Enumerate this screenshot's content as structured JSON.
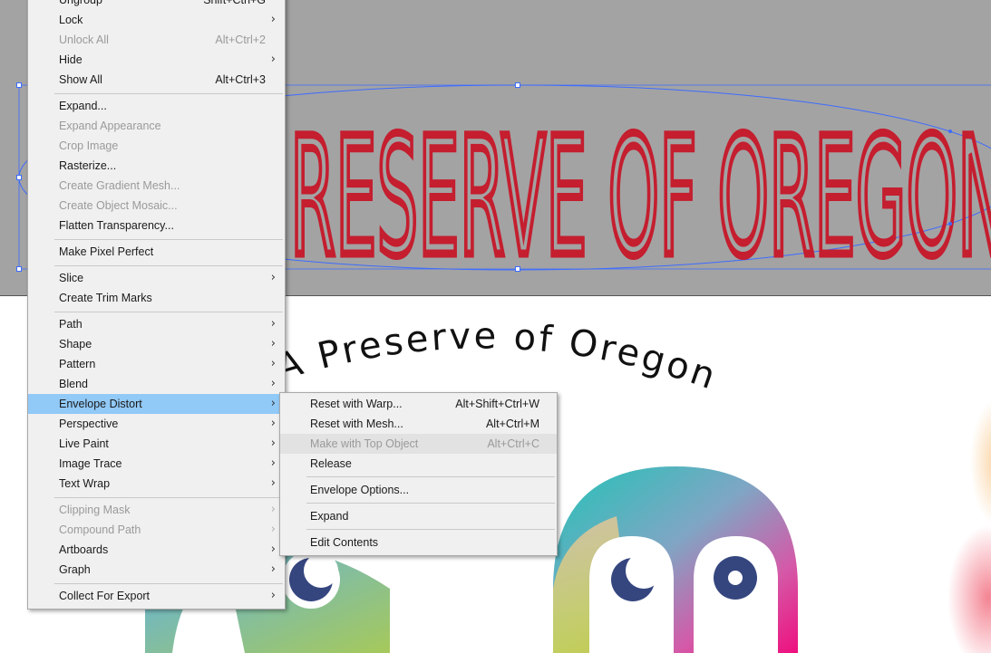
{
  "canvas": {
    "banner_text": "RESERVE OF OREGON",
    "curved_text": "A Preserve of Oregon",
    "colors": {
      "band": "#a3a3a3",
      "banner_text": "#c41e2f",
      "selection": "#3d6bff",
      "eye_dark": "#35467f"
    }
  },
  "main_menu": {
    "items": [
      {
        "label": "Ungroup",
        "shortcut": "Shift+Ctrl+G",
        "arrow": false,
        "disabled": false
      },
      {
        "label": "Lock",
        "shortcut": "",
        "arrow": true,
        "disabled": false
      },
      {
        "label": "Unlock All",
        "shortcut": "Alt+Ctrl+2",
        "arrow": false,
        "disabled": true
      },
      {
        "label": "Hide",
        "shortcut": "",
        "arrow": true,
        "disabled": false
      },
      {
        "label": "Show All",
        "shortcut": "Alt+Ctrl+3",
        "arrow": false,
        "disabled": false
      },
      {
        "label": "Expand...",
        "shortcut": "",
        "arrow": false,
        "disabled": false
      },
      {
        "label": "Expand Appearance",
        "shortcut": "",
        "arrow": false,
        "disabled": true
      },
      {
        "label": "Crop Image",
        "shortcut": "",
        "arrow": false,
        "disabled": true
      },
      {
        "label": "Rasterize...",
        "shortcut": "",
        "arrow": false,
        "disabled": false
      },
      {
        "label": "Create Gradient Mesh...",
        "shortcut": "",
        "arrow": false,
        "disabled": true
      },
      {
        "label": "Create Object Mosaic...",
        "shortcut": "",
        "arrow": false,
        "disabled": true
      },
      {
        "label": "Flatten Transparency...",
        "shortcut": "",
        "arrow": false,
        "disabled": false
      },
      {
        "label": "Make Pixel Perfect",
        "shortcut": "",
        "arrow": false,
        "disabled": false
      },
      {
        "label": "Slice",
        "shortcut": "",
        "arrow": true,
        "disabled": false
      },
      {
        "label": "Create Trim Marks",
        "shortcut": "",
        "arrow": false,
        "disabled": false
      },
      {
        "label": "Path",
        "shortcut": "",
        "arrow": true,
        "disabled": false
      },
      {
        "label": "Shape",
        "shortcut": "",
        "arrow": true,
        "disabled": false
      },
      {
        "label": "Pattern",
        "shortcut": "",
        "arrow": true,
        "disabled": false
      },
      {
        "label": "Blend",
        "shortcut": "",
        "arrow": true,
        "disabled": false
      },
      {
        "label": "Envelope Distort",
        "shortcut": "",
        "arrow": true,
        "disabled": false
      },
      {
        "label": "Perspective",
        "shortcut": "",
        "arrow": true,
        "disabled": false
      },
      {
        "label": "Live Paint",
        "shortcut": "",
        "arrow": true,
        "disabled": false
      },
      {
        "label": "Image Trace",
        "shortcut": "",
        "arrow": true,
        "disabled": false
      },
      {
        "label": "Text Wrap",
        "shortcut": "",
        "arrow": true,
        "disabled": false
      },
      {
        "label": "Clipping Mask",
        "shortcut": "",
        "arrow": true,
        "disabled": true
      },
      {
        "label": "Compound Path",
        "shortcut": "",
        "arrow": true,
        "disabled": true
      },
      {
        "label": "Artboards",
        "shortcut": "",
        "arrow": true,
        "disabled": false
      },
      {
        "label": "Graph",
        "shortcut": "",
        "arrow": true,
        "disabled": false
      },
      {
        "label": "Collect For Export",
        "shortcut": "",
        "arrow": true,
        "disabled": false
      }
    ],
    "highlighted": "Envelope Distort"
  },
  "submenu": {
    "items": [
      {
        "label": "Reset with Warp...",
        "shortcut": "Alt+Shift+Ctrl+W",
        "disabled": false
      },
      {
        "label": "Reset with Mesh...",
        "shortcut": "Alt+Ctrl+M",
        "disabled": false
      },
      {
        "label": "Make with Top Object",
        "shortcut": "Alt+Ctrl+C",
        "disabled": true
      },
      {
        "label": "Release",
        "shortcut": "",
        "disabled": false
      },
      {
        "label": "Envelope Options...",
        "shortcut": "",
        "disabled": false
      },
      {
        "label": "Expand",
        "shortcut": "",
        "disabled": false
      },
      {
        "label": "Edit Contents",
        "shortcut": "",
        "disabled": false
      }
    ],
    "hovered": "Make with Top Object"
  },
  "icons": {
    "submenu_arrow": "chevron-right-icon"
  }
}
